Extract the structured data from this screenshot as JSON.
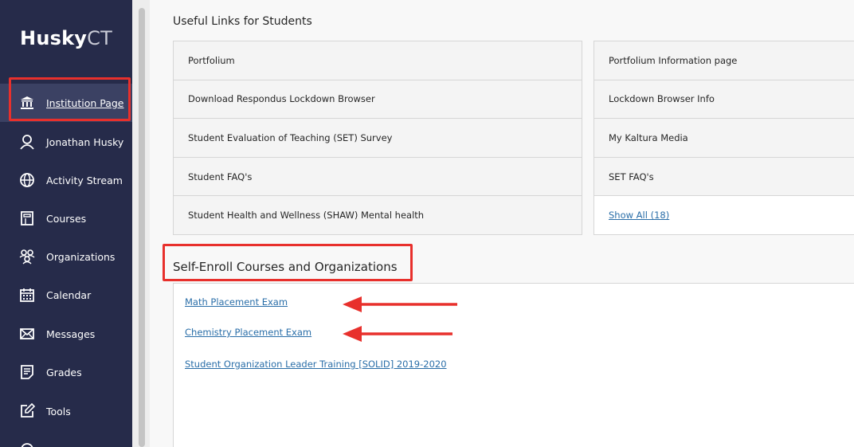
{
  "sidebar": {
    "logo_bold": "Husky",
    "logo_light": "CT",
    "items": [
      {
        "label": "Institution Page",
        "icon": "institution-icon"
      },
      {
        "label": "Jonathan Husky",
        "icon": "user-icon"
      },
      {
        "label": "Activity Stream",
        "icon": "globe-icon"
      },
      {
        "label": "Courses",
        "icon": "courses-icon"
      },
      {
        "label": "Organizations",
        "icon": "organizations-icon"
      },
      {
        "label": "Calendar",
        "icon": "calendar-icon"
      },
      {
        "label": "Messages",
        "icon": "envelope-icon"
      },
      {
        "label": "Grades",
        "icon": "grades-icon"
      },
      {
        "label": "Tools",
        "icon": "tools-icon"
      }
    ]
  },
  "useful_links": {
    "title": "Useful Links for Students",
    "left": [
      "Portfolium",
      "Download Respondus Lockdown Browser",
      "Student Evaluation of Teaching (SET) Survey",
      "Student FAQ's",
      "Student Health and Wellness (SHAW) Mental health"
    ],
    "right": [
      "Portfolium Information page",
      "Lockdown Browser Info",
      "My Kaltura Media",
      "SET FAQ's"
    ],
    "show_all": "Show All (18)"
  },
  "self_enroll": {
    "title": "Self-Enroll Courses and Organizations",
    "links": [
      "Math Placement Exam",
      "Chemistry Placement Exam",
      "Student Organization Leader Training [SOLID] 2019-2020"
    ]
  },
  "colors": {
    "sidebar_bg": "#262b4a",
    "annotation_red": "#e8302c",
    "link_blue": "#2a6ea8"
  }
}
